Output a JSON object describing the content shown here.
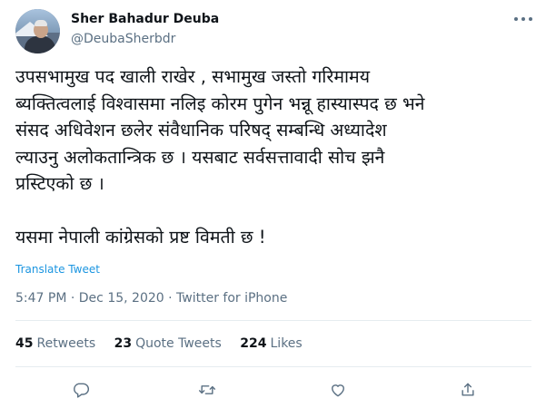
{
  "user": {
    "name": "Sher Bahadur Deuba",
    "handle": "@DeubaSherbdr"
  },
  "tweet": {
    "text": "उपसभामुख पद खाली राखेर , सभामुख जस्तो गरिमामय\nब्यक्तित्वलाई विश्वासमा नलिइ कोरम पुगेन भन्नू हास्यास्पद छ भने\nसंसद अधिवेशन छलेर संवैधानिक परिषद् सम्बन्धि अध्यादेश\nल्याउनु अलोकतान्त्रिक छ । यसबाट सर्वसत्तावादी सोच झनै\nप्रस्टिएको छ ।\n\nयसमा नेपाली कांग्रेसको प्रष्ट विमती छ !",
    "translate_label": "Translate Tweet",
    "time": "5:47 PM",
    "date": "Dec 15, 2020",
    "source": "Twitter for iPhone",
    "separator": "·"
  },
  "stats": {
    "retweets_count": "45",
    "retweets_label": "Retweets",
    "quotes_count": "23",
    "quotes_label": "Quote Tweets",
    "likes_count": "224",
    "likes_label": "Likes"
  },
  "icons": {
    "more": "more-options-icon",
    "reply": "reply-icon",
    "retweet": "retweet-icon",
    "like": "heart-icon",
    "share": "share-icon"
  },
  "colors": {
    "text": "#0f1419",
    "secondary": "#5b7083",
    "link": "#1b95e0",
    "divider": "#e6ecf0"
  }
}
